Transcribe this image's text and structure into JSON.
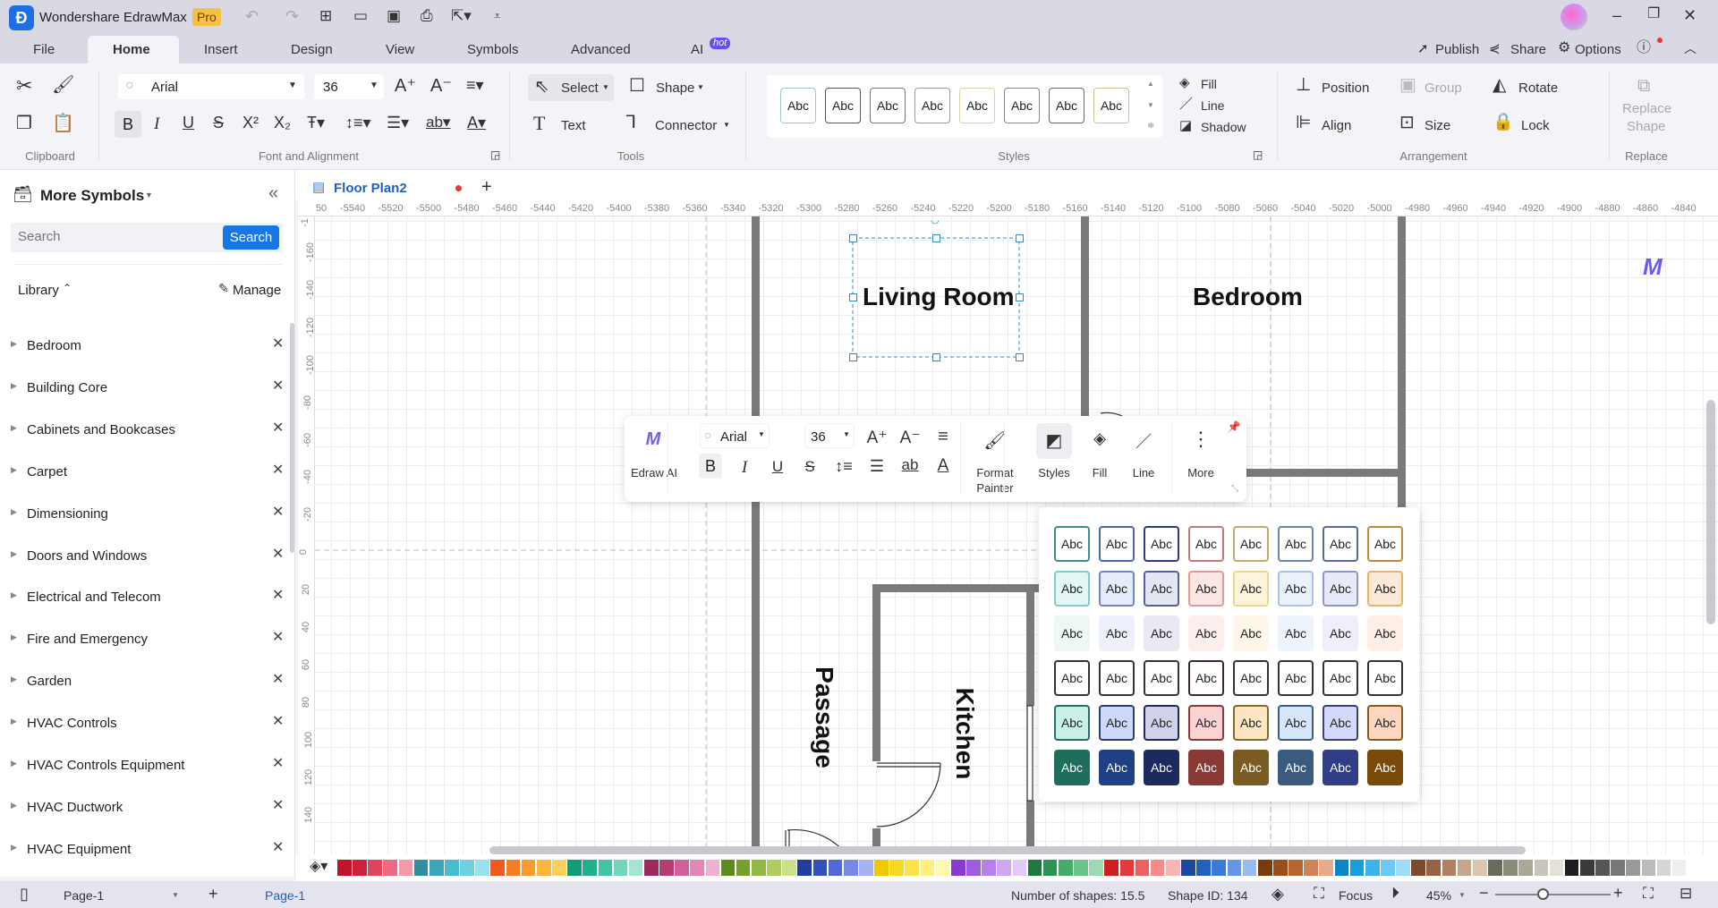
{
  "app": {
    "title": "Wondershare EdrawMax",
    "badge": "Pro"
  },
  "menu_tabs": [
    "File",
    "Home",
    "Insert",
    "Design",
    "View",
    "Symbols",
    "Advanced",
    "AI"
  ],
  "ai_badge": "hot",
  "header_actions": {
    "publish": "Publish",
    "share": "Share",
    "options": "Options"
  },
  "ribbon": {
    "clipboard_label": "Clipboard",
    "font": "Arial",
    "font_size": "36",
    "font_group_label": "Font and Alignment",
    "tools": {
      "select": "Select",
      "shape": "Shape",
      "text": "Text",
      "connector": "Connector",
      "label": "Tools"
    },
    "styles_label": "Styles",
    "style_sample": "Abc",
    "style_borders": [
      "#9ac9c4",
      "#555",
      "#777",
      "#999",
      "#d9d2a8",
      "#888",
      "#666",
      "#c9c08a"
    ],
    "fill": "Fill",
    "line": "Line",
    "shadow": "Shadow",
    "arrangement": {
      "position": "Position",
      "group": "Group",
      "rotate": "Rotate",
      "align": "Align",
      "size": "Size",
      "lock": "Lock",
      "label": "Arrangement"
    },
    "replace": {
      "line1": "Replace",
      "line2": "Shape",
      "label": "Replace"
    }
  },
  "document_tab": {
    "name": "Floor Plan2"
  },
  "sidebar": {
    "title": "More Symbols",
    "search_placeholder": "Search",
    "search_button": "Search",
    "library": "Library",
    "manage": "Manage",
    "items": [
      "Bedroom",
      "Building Core",
      "Cabinets and Bookcases",
      "Carpet",
      "Dimensioning",
      "Doors and Windows",
      "Electrical and Telecom",
      "Fire and Emergency",
      "Garden",
      "HVAC Controls",
      "HVAC Controls Equipment",
      "HVAC Ductwork",
      "HVAC Equipment"
    ]
  },
  "ruler": {
    "top": [
      "50",
      "-5540",
      "-5520",
      "-5500",
      "-5480",
      "-5460",
      "-5440",
      "-5420",
      "-5400",
      "-5380",
      "-5360",
      "-5340",
      "-5320",
      "-5300",
      "-5280",
      "-5260",
      "-5240",
      "-5220",
      "-5200",
      "-5180",
      "-5160",
      "-5140",
      "-5120",
      "-5100",
      "-5080",
      "-5060",
      "-5040",
      "-5020",
      "-5000",
      "-4980",
      "-4960",
      "-4940",
      "-4920",
      "-4900",
      "-4880",
      "-4860",
      "-4840"
    ],
    "left": [
      "-1",
      "-160",
      "-140",
      "-120",
      "-100",
      "-80",
      "-60",
      "-40",
      "-20",
      "0",
      "20",
      "40",
      "60",
      "80",
      "100",
      "120",
      "140"
    ]
  },
  "canvas": {
    "rooms": {
      "living": "Living Room",
      "bedroom": "Bedroom",
      "passage": "Passage",
      "kitchen": "Kitchen"
    },
    "wall_color": "#7a7a7a",
    "selection_color": "#2b8cc4"
  },
  "floating_toolbar": {
    "edraw_ai": "Edraw AI",
    "font": "Arial",
    "font_size": "36",
    "format_painter_1": "Format",
    "format_painter_2": "Painter",
    "styles": "Styles",
    "fill": "Fill",
    "line": "Line",
    "more": "More"
  },
  "style_panel": {
    "sample": "Abc",
    "rows": [
      {
        "text": "#222",
        "fills": [
          "#fff",
          "#fff",
          "#fff",
          "#fff",
          "#fff",
          "#fff",
          "#fff",
          "#fff"
        ],
        "borders": [
          "#3e8f8a",
          "#4a66a8",
          "#2f3a80",
          "#c07a78",
          "#c9a866",
          "#6d86a8",
          "#5a66a0",
          "#c08a3a"
        ]
      },
      {
        "text": "#222",
        "fills": [
          "#e3f6f4",
          "#e6ecfb",
          "#e4e6f2",
          "#fde6e4",
          "#fdf4dc",
          "#eaf3fc",
          "#e8eafa",
          "#fde9d8"
        ],
        "borders": [
          "#7ccfc8",
          "#6f86c8",
          "#565f9a",
          "#e29a98",
          "#f0d68a",
          "#a7c3ea",
          "#8c95cf",
          "#e8b46a"
        ]
      },
      {
        "text": "#222",
        "fills": [
          "#edf7f5",
          "#eef0fc",
          "#e8e9f2",
          "#fdeeee",
          "#fef7ea",
          "#eef4fc",
          "#eeeffb",
          "#fdefe6"
        ],
        "borders": [
          "#edf7f5",
          "#eef0fc",
          "#e8e9f2",
          "#fdeeee",
          "#fef7ea",
          "#eef4fc",
          "#eeeffb",
          "#fdefe6"
        ]
      },
      {
        "text": "#222",
        "fills": [
          "#fff",
          "#fff",
          "#fff",
          "#fff",
          "#fff",
          "#fff",
          "#fff",
          "#fff"
        ],
        "borders": [
          "#333",
          "#333",
          "#333",
          "#3d2a2a",
          "#333",
          "#333",
          "#333",
          "#333"
        ]
      },
      {
        "text": "#222",
        "fills": [
          "#c9efe8",
          "#cdd8fb",
          "#cfd2ea",
          "#fdd2d2",
          "#fde6c2",
          "#d6e5fb",
          "#d4d8fb",
          "#fdd7c0"
        ],
        "borders": [
          "#2c6d66",
          "#2a3d7a",
          "#23295e",
          "#8a3a3a",
          "#8a6a2a",
          "#3d5a80",
          "#3a4080",
          "#8a5a22"
        ]
      },
      {
        "text": "#fff",
        "fills": [
          "#1f6e5c",
          "#1f3f86",
          "#1c2a60",
          "#8a3a34",
          "#7a5c22",
          "#3a5a80",
          "#2f3e86",
          "#7a4a0a"
        ],
        "borders": [
          "#1f6e5c",
          "#1f3f86",
          "#1c2a60",
          "#8a3a34",
          "#7a5c22",
          "#3a5a80",
          "#2f3e86",
          "#7a4a0a"
        ]
      }
    ]
  },
  "color_palette": [
    "#c0142b",
    "#d1203b",
    "#e0445f",
    "#ee6a82",
    "#f59aa8",
    "#2e8fa0",
    "#3aa6b8",
    "#4bbcd0",
    "#6fd0e0",
    "#98e1ef",
    "#f05a22",
    "#f77c26",
    "#fb9a2c",
    "#fdb63a",
    "#fdd05a",
    "#139a7a",
    "#1fb08c",
    "#42c4a2",
    "#72d6bc",
    "#a2e6d4",
    "#9c2a5c",
    "#b83c74",
    "#d0609a",
    "#e486b6",
    "#f2b0d0",
    "#5e8a1e",
    "#76a22a",
    "#92b83e",
    "#afcc5e",
    "#cce08a",
    "#1f3fa0",
    "#3250c0",
    "#5068d8",
    "#7888e6",
    "#a8b2f2",
    "#f0c800",
    "#f8d820",
    "#fce448",
    "#fef07a",
    "#fff8b0",
    "#8a3ad0",
    "#a25ce0",
    "#b880ea",
    "#cea6f2",
    "#e2cafa",
    "#1e7a3c",
    "#2a9450",
    "#44ac68",
    "#6cc48c",
    "#9cdab4",
    "#d01e1e",
    "#e43a3a",
    "#f05e5e",
    "#f68a8a",
    "#fab4b4",
    "#1a4aa0",
    "#2460c0",
    "#3c7ad8",
    "#6498e6",
    "#98bcf2",
    "#7a3a0a",
    "#9a4e1a",
    "#b8642e",
    "#d08456",
    "#e4ac88",
    "#0a86c8",
    "#1a9ce0",
    "#3cb2ee",
    "#6cc8f4",
    "#a0dcf8",
    "#7a4a2a",
    "#966242",
    "#b08060",
    "#c8a488",
    "#dcc6b0",
    "#6a6a5a",
    "#8a8a78",
    "#aaa898",
    "#c8c6b8",
    "#e4e2d8",
    "#1e1e1e",
    "#3a3a3a",
    "#555555",
    "#777777",
    "#999999",
    "#bbbbbb",
    "#d6d6d6",
    "#eeeeee"
  ],
  "status": {
    "page_select": "Page-1",
    "page_tab": "Page-1",
    "shapes": "Number of shapes: 15.5",
    "shape_id": "Shape ID: 134",
    "focus": "Focus",
    "zoom": "45%",
    "zoom_level_percent": 45
  }
}
